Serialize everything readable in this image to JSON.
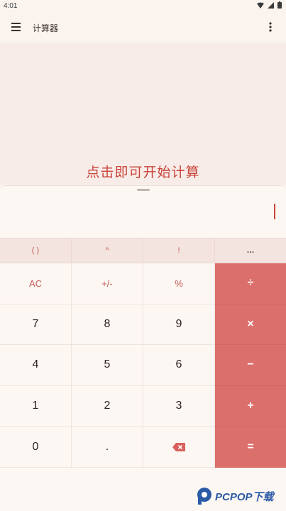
{
  "status": {
    "time": "4:01"
  },
  "app_bar": {
    "title": "计算器"
  },
  "display": {
    "hint": "点击即可开始计算"
  },
  "scientific_row": [
    "( )",
    "^",
    "!",
    "…"
  ],
  "keypad": {
    "rows": [
      [
        "AC",
        "+/-",
        "%",
        "÷"
      ],
      [
        "7",
        "8",
        "9",
        "×"
      ],
      [
        "4",
        "5",
        "6",
        "−"
      ],
      [
        "1",
        "2",
        "3",
        "+"
      ],
      [
        "0",
        ".",
        "backspace",
        "="
      ]
    ]
  },
  "watermark": {
    "text": "PCPOP下载"
  },
  "colors": {
    "accent": "#db6f6c",
    "hint_red": "#c9433b",
    "background": "#fbf3ee"
  }
}
